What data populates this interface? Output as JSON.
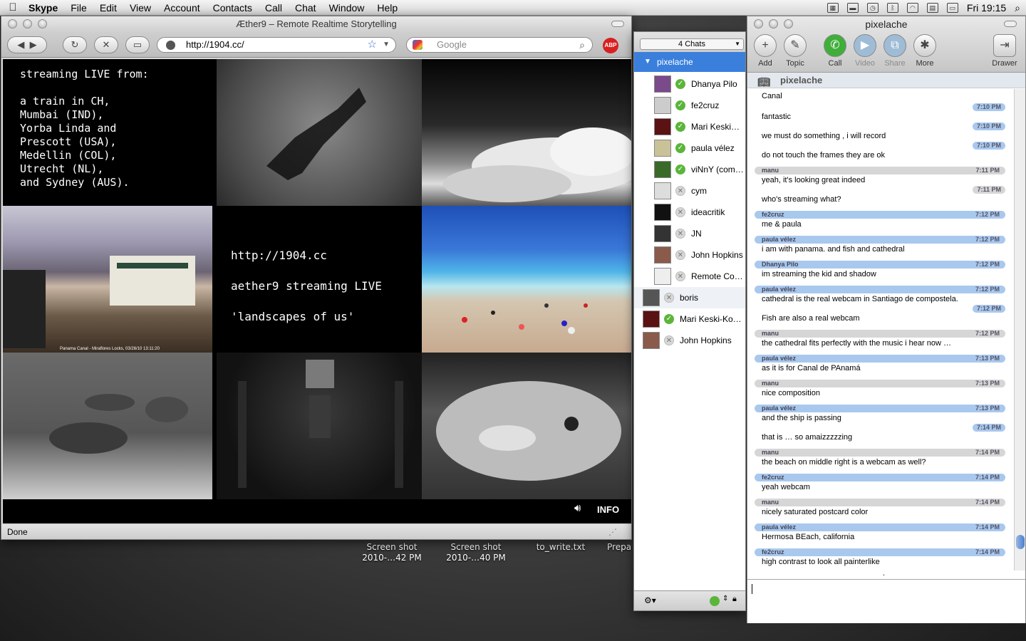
{
  "menubar": {
    "app": "Skype",
    "items": [
      "File",
      "Edit",
      "View",
      "Account",
      "Contacts",
      "Call",
      "Chat",
      "Window",
      "Help"
    ],
    "clock": "Fri 19:15"
  },
  "desktop": {
    "icons": [
      {
        "label1": "Screen shot",
        "label2": "2010-…42 PM"
      },
      {
        "label1": "Screen shot",
        "label2": "2010-…40 PM"
      },
      {
        "label1": "to_write.txt",
        "label2": ""
      },
      {
        "label1": "Prepa",
        "label2": ""
      }
    ]
  },
  "browser": {
    "title": "Æther9 – Remote Realtime Storytelling",
    "url": "http://1904.cc/",
    "search_placeholder": "Google",
    "adblock": "ABP",
    "status": "Done",
    "info": "INFO",
    "tiles": {
      "intro_heading": "streaming LIVE from:",
      "intro_lines": [
        "a train in CH,",
        "Mumbai (IND),",
        "Yorba Linda and",
        "Prescott (USA),",
        "Medellin (COL),",
        "Utrecht (NL),",
        "and Sydney (AUS)."
      ],
      "center_lines": [
        "http://1904.cc",
        "aether9 streaming LIVE",
        "'landscapes of us'"
      ],
      "panama_caption": "Panama Canal - Miraflores Locks, 03/26/10 13:11:20"
    }
  },
  "chats": {
    "count": "4 Chats",
    "group": "pixelache",
    "members": [
      {
        "name": "Dhanya Pilo",
        "status": "online",
        "avatar": "#7b4a8a"
      },
      {
        "name": "fe2cruz",
        "status": "online",
        "avatar": "#ccc"
      },
      {
        "name": "Mari Keski…",
        "status": "online",
        "avatar": "#5a1212"
      },
      {
        "name": "paula vélez",
        "status": "online",
        "avatar": "#c9c298"
      },
      {
        "name": "viNnY (com…",
        "status": "online",
        "avatar": "#3a6a2a"
      },
      {
        "name": "cym",
        "status": "offline",
        "avatar": "#ddd"
      },
      {
        "name": "ideacritik",
        "status": "offline",
        "avatar": "#111"
      },
      {
        "name": "JN",
        "status": "offline",
        "avatar": "#333"
      },
      {
        "name": "John Hopkins",
        "status": "offline",
        "avatar": "#8a5a4a"
      },
      {
        "name": "Remote Co…",
        "status": "offline",
        "avatar": "#eee"
      }
    ],
    "others": [
      {
        "name": "boris",
        "status": "offline",
        "avatar": "#555"
      },
      {
        "name": "Mari Keski-Ko…",
        "status": "online",
        "avatar": "#5a1212"
      },
      {
        "name": "John Hopkins",
        "status": "offline",
        "avatar": "#8a5a4a"
      }
    ]
  },
  "skype": {
    "title": "pixelache",
    "toolbar": [
      {
        "label": "Add",
        "icon": "+",
        "enabled": true
      },
      {
        "label": "Topic",
        "icon": "✎",
        "enabled": true
      },
      {
        "label": "Call",
        "icon": "✆",
        "enabled": true
      },
      {
        "label": "Video",
        "icon": "▶",
        "enabled": false
      },
      {
        "label": "Share",
        "icon": "⧉",
        "enabled": false
      },
      {
        "label": "More",
        "icon": "✱",
        "enabled": true
      }
    ],
    "drawer": "Drawer",
    "conversation": "pixelache",
    "messages": [
      {
        "who": "",
        "time": "",
        "text": "Canal",
        "color": ""
      },
      {
        "who": "",
        "time": "7:10 PM",
        "text": "fantastic",
        "color": "blue"
      },
      {
        "who": "",
        "time": "7:10 PM",
        "text": "we must do something , i will record",
        "color": "blue"
      },
      {
        "who": "",
        "time": "7:10 PM",
        "text": "do not touch the frames they are ok",
        "color": "blue"
      },
      {
        "who": "manu",
        "time": "7:11 PM",
        "text": "yeah, it's looking great indeed",
        "color": "gray"
      },
      {
        "who": "",
        "time": "7:11 PM",
        "text": "who's streaming what?",
        "color": "gray"
      },
      {
        "who": "fe2cruz",
        "time": "7:12 PM",
        "text": "me & paula",
        "color": "blue"
      },
      {
        "who": "paula vélez",
        "time": "7:12 PM",
        "text": "i am with panama. and fish and cathedral",
        "color": "blue"
      },
      {
        "who": "Dhanya Pilo",
        "time": "7:12 PM",
        "text": "im streaming the kid and shadow",
        "color": "blue"
      },
      {
        "who": "paula vélez",
        "time": "7:12 PM",
        "text": "cathedral is the real webcam in Santiago de compostela.",
        "color": "blue"
      },
      {
        "who": "",
        "time": "7:12 PM",
        "text": "Fish are also a real webcam",
        "color": "blue"
      },
      {
        "who": "manu",
        "time": "7:12 PM",
        "text": "the cathedral fits perfectly with the music i hear now …",
        "color": "gray"
      },
      {
        "who": "paula vélez",
        "time": "7:13 PM",
        "text": "as it is for Canal de PAnamá",
        "color": "blue"
      },
      {
        "who": "manu",
        "time": "7:13 PM",
        "text": "nice composition",
        "color": "gray"
      },
      {
        "who": "paula vélez",
        "time": "7:13 PM",
        "text": "and the ship is passing",
        "color": "blue"
      },
      {
        "who": "",
        "time": "7:14 PM",
        "text": "that is … so amaizzzzzing",
        "color": "blue"
      },
      {
        "who": "manu",
        "time": "7:14 PM",
        "text": "the beach on middle right is a webcam as well?",
        "color": "gray"
      },
      {
        "who": "fe2cruz",
        "time": "7:14 PM",
        "text": "yeah webcam",
        "color": "blue"
      },
      {
        "who": "manu",
        "time": "7:14 PM",
        "text": "nicely saturated postcard color",
        "color": "gray"
      },
      {
        "who": "paula vélez",
        "time": "7:14 PM",
        "text": "Hermosa BEach, california",
        "color": "blue"
      },
      {
        "who": "fe2cruz",
        "time": "7:14 PM",
        "text": "high contrast to look all painterlike",
        "color": "blue"
      }
    ]
  },
  "colors": {
    "blue_bar": "#a9c8ee",
    "gray_bar": "#d6d6d6",
    "selected": "#3a7fdc"
  }
}
